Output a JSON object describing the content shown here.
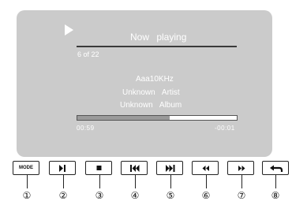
{
  "now_playing": {
    "header": "Now playing",
    "track_count": "6 of 22",
    "title": "Aaa10KHz",
    "artist": "Unknown Artist",
    "album": "Unknown Album",
    "elapsed": "00:59",
    "remaining": "-00:01",
    "progress": 0.58
  },
  "controls": [
    {
      "name": "mode",
      "label": "MODE",
      "icon": "mode-icon",
      "number": "①"
    },
    {
      "name": "play-pause",
      "label": "",
      "icon": "play-pause-icon",
      "number": "②"
    },
    {
      "name": "stop",
      "label": "",
      "icon": "stop-icon",
      "number": "③"
    },
    {
      "name": "previous",
      "label": "",
      "icon": "skip-previous-icon",
      "number": "④"
    },
    {
      "name": "next",
      "label": "",
      "icon": "skip-next-icon",
      "number": "⑤"
    },
    {
      "name": "rewind",
      "label": "",
      "icon": "rewind-icon",
      "number": "⑥"
    },
    {
      "name": "fast-forward",
      "label": "",
      "icon": "fast-forward-icon",
      "number": "⑦"
    },
    {
      "name": "back",
      "label": "",
      "icon": "return-arrow-icon",
      "number": "⑧"
    }
  ],
  "colors": {
    "screen": "#cbcbcb",
    "text": "#ffffff",
    "progress_fill": "#9a9a9a"
  }
}
